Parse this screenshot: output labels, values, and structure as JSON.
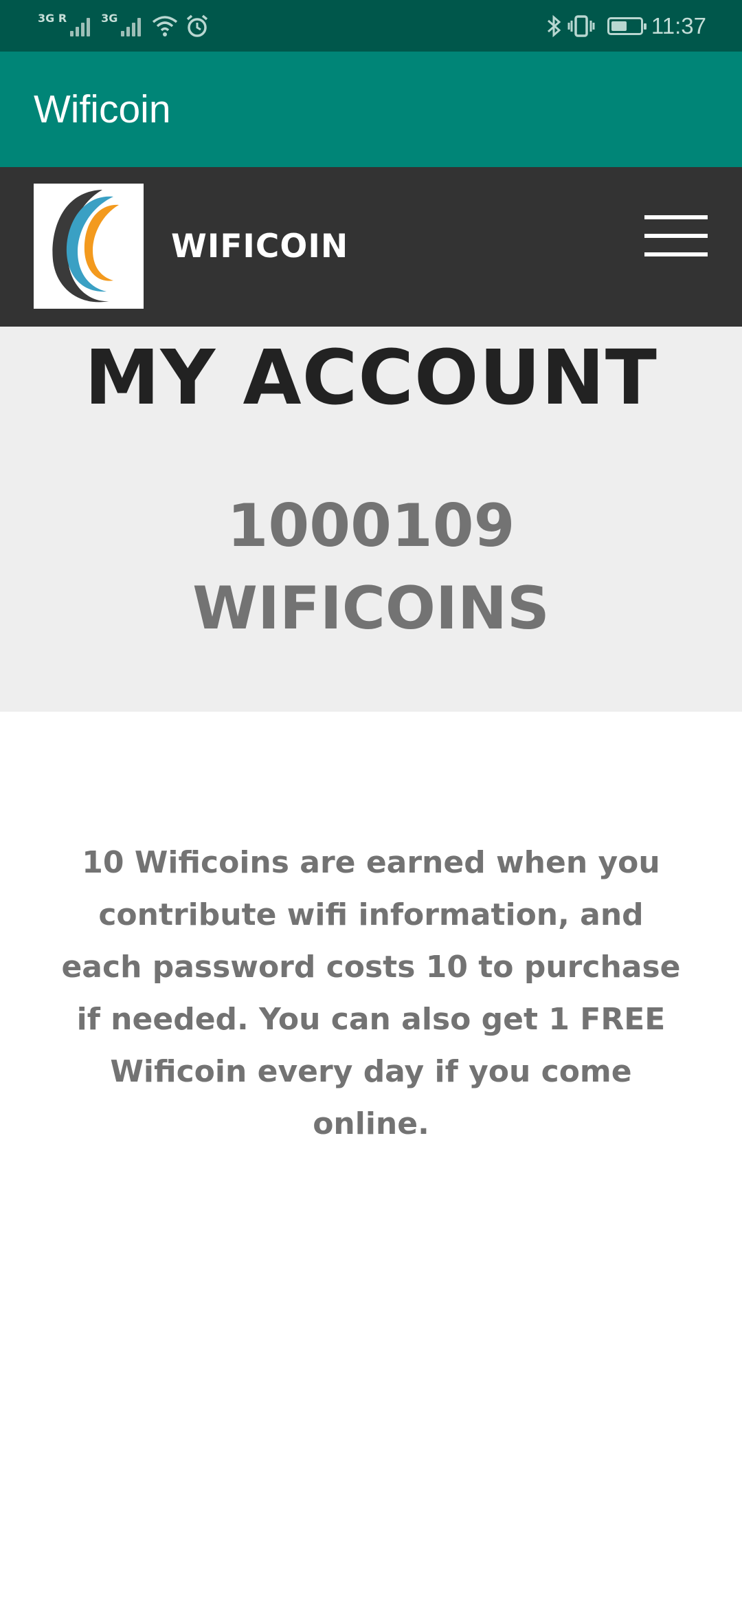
{
  "status_bar": {
    "sim1_label": "3G R",
    "sim2_label": "3G",
    "time": "11:37",
    "icons": [
      "signal-icon",
      "signal-icon",
      "wifi-icon",
      "alarm-icon",
      "bluetooth-icon",
      "vibrate-icon",
      "battery-icon"
    ]
  },
  "app_bar": {
    "title": "Wificoin"
  },
  "site_nav": {
    "site_name": "WIFICOIN",
    "logo_icon": "wificoin-logo",
    "menu_icon": "hamburger-menu-icon"
  },
  "hero": {
    "title": "MY ACCOUNT",
    "balance_amount": "1000109",
    "balance_unit": "WIFICOINS"
  },
  "info": {
    "text": "10 Wificoins are earned when you contribute wifi information, and each password costs 10 to purchase if needed. You can also get 1 FREE Wificoin every day if you come online."
  },
  "colors": {
    "status_bar": "#00574b",
    "app_bar": "#008577",
    "site_nav": "#333333",
    "hero_bg": "#eeeeee",
    "text_gray": "#737373"
  }
}
